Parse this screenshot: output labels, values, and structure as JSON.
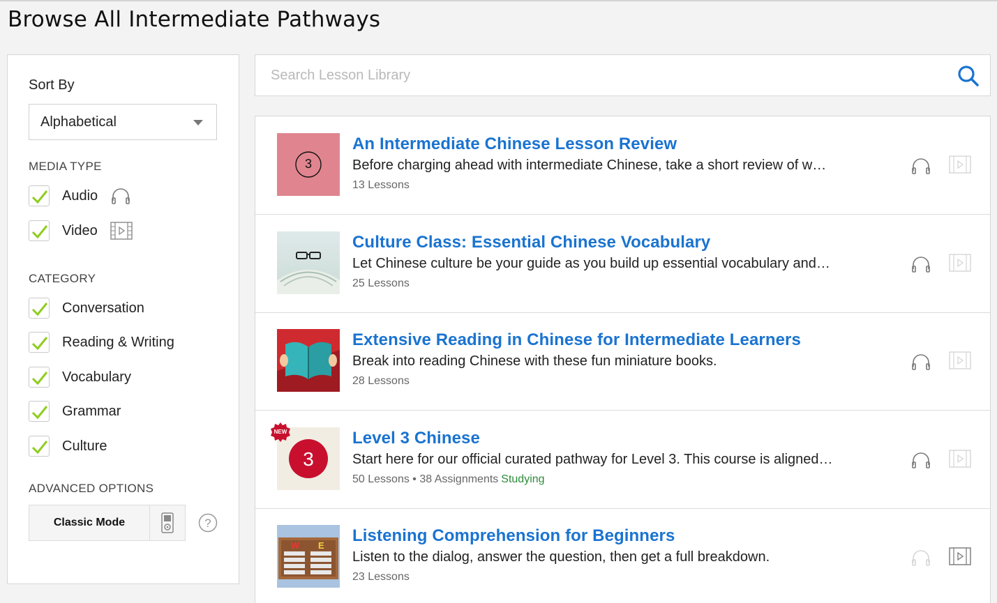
{
  "page": {
    "title": "Browse All Intermediate Pathways"
  },
  "sidebar": {
    "sort_label": "Sort By",
    "sort_value": "Alphabetical",
    "media_type_heading": "MEDIA TYPE",
    "media_types": [
      {
        "label": "Audio",
        "checked": true,
        "icon": "headphones-icon"
      },
      {
        "label": "Video",
        "checked": true,
        "icon": "video-icon"
      }
    ],
    "category_heading": "CATEGORY",
    "categories": [
      {
        "label": "Conversation",
        "checked": true
      },
      {
        "label": "Reading & Writing",
        "checked": true
      },
      {
        "label": "Vocabulary",
        "checked": true
      },
      {
        "label": "Grammar",
        "checked": true
      },
      {
        "label": "Culture",
        "checked": true
      }
    ],
    "advanced_heading": "ADVANCED OPTIONS",
    "classic_mode_label": "Classic Mode"
  },
  "search": {
    "placeholder": "Search Lesson Library"
  },
  "results": [
    {
      "title": "An Intermediate Chinese Lesson Review",
      "description": "Before charging ahead with intermediate Chinese, take a short review of what you've learned so far.",
      "meta": "13 Lessons",
      "thumb_text": "3"
    },
    {
      "title": "Culture Class: Essential Chinese Vocabulary",
      "description": "Let Chinese culture be your guide as you build up essential vocabulary and cultural knowledge.",
      "meta": "25 Lessons"
    },
    {
      "title": "Extensive Reading in Chinese for Intermediate Learners",
      "description": "Break into reading Chinese with these fun miniature books.",
      "meta": "28 Lessons"
    },
    {
      "title": "Level 3 Chinese",
      "description": "Start here for our official curated pathway for Level 3. This course is aligned with international standards.",
      "meta": "50 Lessons • 38 Assignments",
      "status": "Studying",
      "badge": "NEW",
      "thumb_text": "3"
    },
    {
      "title": "Listening Comprehension for Beginners",
      "description": "Listen to the dialog, answer the question, then get a full breakdown.",
      "meta": "23 Lessons",
      "thumb_letters": [
        "W",
        "E"
      ]
    }
  ],
  "colors": {
    "accent_blue": "#1a73d0",
    "check_green": "#8fcc1f",
    "studying_green": "#2e8b3a",
    "badge_red": "#c8102e"
  }
}
